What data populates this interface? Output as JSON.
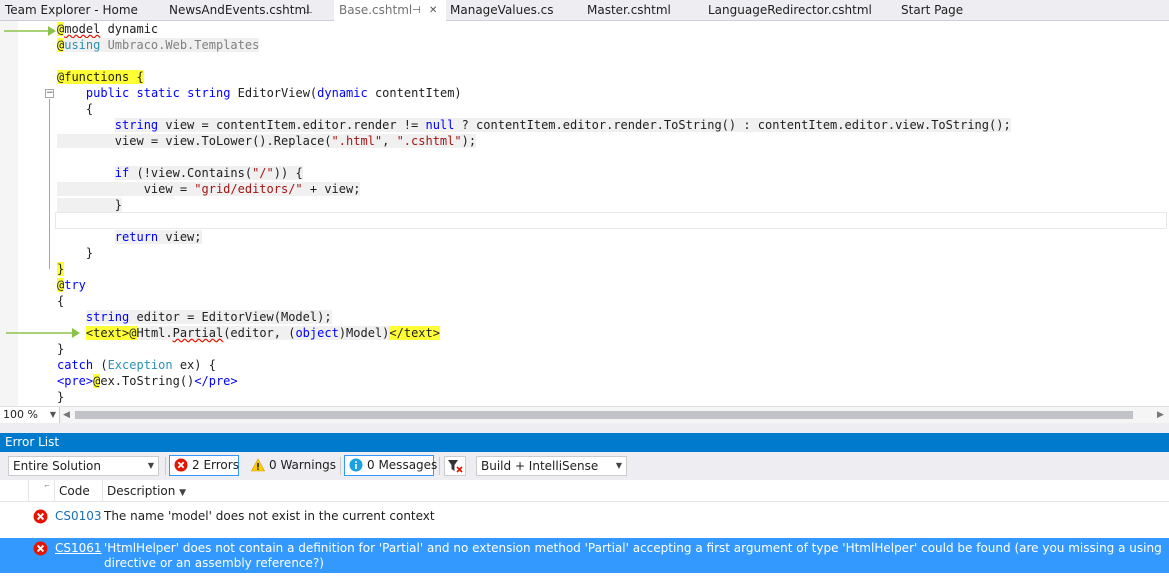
{
  "tabs": [
    {
      "label": "Team Explorer - Home",
      "active": false
    },
    {
      "label": "NewsAndEvents.cshtml",
      "active": false,
      "pin": "⊥"
    },
    {
      "label": "Base.cshtml",
      "active": true,
      "pin": "⊣",
      "close": "✕"
    },
    {
      "label": "ManageValues.cs",
      "active": false
    },
    {
      "label": "Master.cshtml",
      "active": false
    },
    {
      "label": "LanguageRedirector.cshtml",
      "active": false
    },
    {
      "label": "Start Page",
      "active": false
    }
  ],
  "code": [
    [
      [
        "@",
        "hl-y"
      ],
      [
        "model",
        "sq"
      ],
      [
        " dynamic",
        ""
      ]
    ],
    [
      [
        "@",
        "hl-y"
      ],
      [
        "using",
        "ty hl-g"
      ],
      [
        " Umbraco.Web.Templates",
        "gr hl-g"
      ]
    ],
    [],
    [
      [
        "@functions {",
        "hl-y"
      ]
    ],
    [
      [
        "    ",
        ""
      ],
      [
        "public",
        "kw"
      ],
      [
        " ",
        ""
      ],
      [
        "static",
        "kw"
      ],
      [
        " ",
        ""
      ],
      [
        "string",
        "kw"
      ],
      [
        " EditorView(",
        ""
      ],
      [
        "dynamic",
        "kw"
      ],
      [
        " contentItem)",
        ""
      ]
    ],
    [
      [
        "    {",
        ""
      ]
    ],
    [
      [
        "        ",
        ""
      ],
      [
        "string",
        "kw hl-g"
      ],
      [
        " view = contentItem.editor.render != ",
        "hl-g"
      ],
      [
        "null",
        "kw hl-g"
      ],
      [
        " ? contentItem.editor.render.ToString() : contentItem.editor.view.ToString();",
        "hl-g"
      ]
    ],
    [
      [
        "        view = view.ToLower().Replace(",
        "hl-g"
      ],
      [
        "\".html\"",
        "st hl-g"
      ],
      [
        ", ",
        "hl-g"
      ],
      [
        "\".cshtml\"",
        "st hl-g"
      ],
      [
        ");",
        "hl-g"
      ]
    ],
    [],
    [
      [
        "        ",
        ""
      ],
      [
        "if",
        "kw hl-g"
      ],
      [
        " (!view.Contains(",
        "hl-g"
      ],
      [
        "\"/\"",
        "st hl-g"
      ],
      [
        ")) {",
        "hl-g"
      ]
    ],
    [
      [
        "            view = ",
        "hl-g"
      ],
      [
        "\"grid/editors/\"",
        "st hl-g"
      ],
      [
        " + view;",
        "hl-g"
      ]
    ],
    [
      [
        "        }",
        "hl-g"
      ]
    ],
    [],
    [
      [
        "        ",
        ""
      ],
      [
        "return",
        "kw hl-g"
      ],
      [
        " view;",
        "hl-g"
      ]
    ],
    [
      [
        "    }",
        ""
      ]
    ],
    [
      [
        "}",
        "hl-y"
      ]
    ],
    [
      [
        "@",
        "hl-y"
      ],
      [
        "try",
        "kw"
      ]
    ],
    [
      [
        "{",
        ""
      ]
    ],
    [
      [
        "    ",
        ""
      ],
      [
        "string",
        "kw hl-g"
      ],
      [
        " editor = EditorView(Model);",
        "hl-g"
      ]
    ],
    [
      [
        "    ",
        ""
      ],
      [
        "<text>",
        "hl-y"
      ],
      [
        "@",
        "hl-y"
      ],
      [
        "Html.",
        "hl-g"
      ],
      [
        "Partial",
        "hl-g sq"
      ],
      [
        "(editor, (",
        "hl-g"
      ],
      [
        "object",
        "kw hl-g"
      ],
      [
        ")Model)",
        "hl-g"
      ],
      [
        "</text>",
        "hl-y"
      ]
    ],
    [
      [
        "}",
        ""
      ]
    ],
    [
      [
        "catch",
        "kw"
      ],
      [
        " (",
        ""
      ],
      [
        "Exception",
        "ty"
      ],
      [
        " ex) {",
        ""
      ]
    ],
    [
      [
        "<pre>",
        "kw"
      ],
      [
        "@",
        "hl-y"
      ],
      [
        "ex.ToString()",
        ""
      ],
      [
        "</pre>",
        "kw"
      ]
    ],
    [
      [
        "}",
        ""
      ]
    ]
  ],
  "zoom": "100 %",
  "error_list": {
    "title": "Error List",
    "scope": "Entire Solution",
    "errors_btn": "2 Errors",
    "warnings_btn": "0 Warnings",
    "messages_btn": "0 Messages",
    "build": "Build + IntelliSense",
    "columns": {
      "code": "Code",
      "description": "Description"
    },
    "rows": [
      {
        "code": "CS0103",
        "description": "The name 'model' does not exist in the current context",
        "selected": false
      },
      {
        "code": "CS1061",
        "description": "'HtmlHelper' does not contain a definition for 'Partial' and no extension method 'Partial' accepting a first argument of type 'HtmlHelper' could be found (are you missing a using directive or an assembly reference?)",
        "selected": true
      }
    ]
  },
  "colors": {
    "accent": "#007acc",
    "selection": "#3399ff",
    "highlight": "#ffff36",
    "error": "#e51400"
  }
}
